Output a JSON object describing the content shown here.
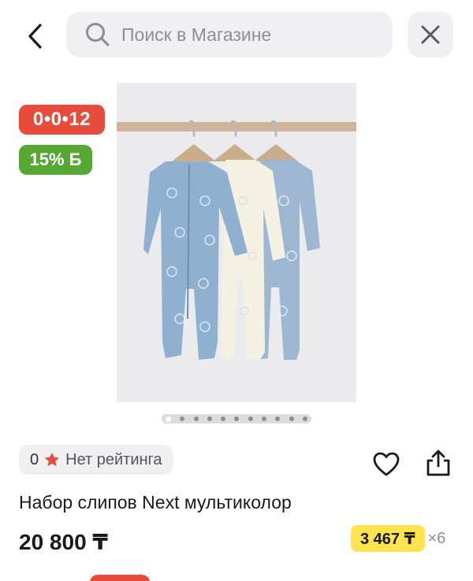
{
  "header": {
    "back_icon": "chevron-left-icon",
    "search_placeholder": "Поиск в Магазине",
    "close_icon": "close-icon"
  },
  "badges": {
    "installment": "0•0•12",
    "installment_color": "#e64b3c",
    "bonus": "15% Б",
    "bonus_color": "#57a734"
  },
  "gallery": {
    "total_images": 11,
    "active_index": 0
  },
  "rating": {
    "count": "0",
    "label": "Нет рейтинга",
    "star_color": "#e64b3c"
  },
  "actions": {
    "favorite_icon": "heart-icon",
    "share_icon": "share-icon"
  },
  "product": {
    "title": "Набор слипов Next мультиколор",
    "price": "20 800 ₸",
    "installment_amount": "3 467 ₸",
    "installment_times": "×6",
    "installment_highlight": "#ffe34f"
  }
}
